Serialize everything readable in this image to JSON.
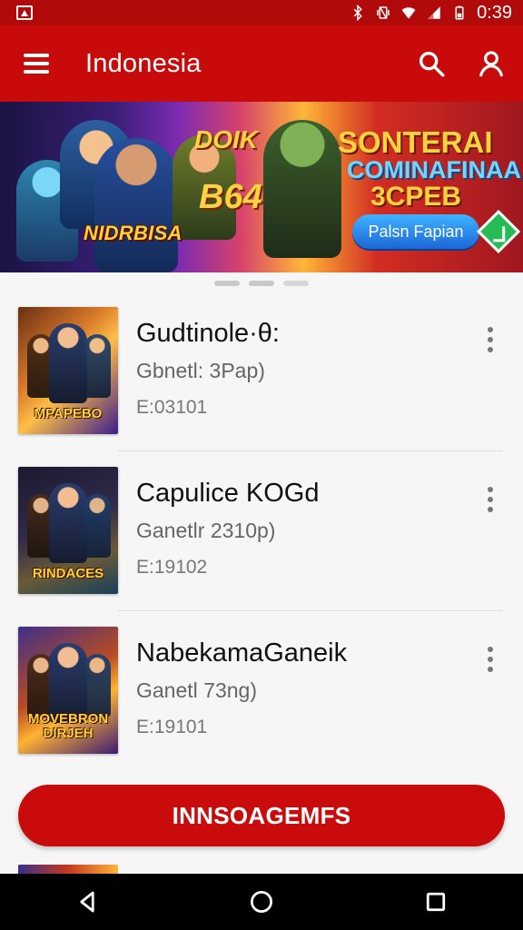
{
  "status_bar": {
    "time": "0:39",
    "icons": [
      "notification-icon",
      "bluetooth-icon",
      "vibrate-icon",
      "wifi-icon",
      "signal-icon",
      "battery-icon"
    ]
  },
  "app_bar": {
    "title": "Indonesia",
    "icons": [
      "menu-icon",
      "search-icon",
      "account-icon"
    ],
    "accent_color": "#c80a0a"
  },
  "banner": {
    "brand_text": "NIDRBISA",
    "center_text_1": "DOIK",
    "center_text_2": "B64",
    "promo_line_1": "SONTERAI",
    "promo_line_2": "COMINAFINAA",
    "promo_line_3": "3CPEB",
    "cta_label": "Palsn Fapian",
    "carousel_dots": 3,
    "active_dot": 1
  },
  "list": {
    "items": [
      {
        "title": "Gudtinole·θ:",
        "subtitle": "Gbnetl: 3Pap)",
        "meta": "E:03101",
        "thumb_caption": "MPAPEBO"
      },
      {
        "title": "Capulice KOGd",
        "subtitle": "Ganetlr 2310p)",
        "meta": "E:19102",
        "thumb_caption": "RINDACES"
      },
      {
        "title": "NabekamaGaneik",
        "subtitle": "Ganetl 73ng)",
        "meta": "E:19101",
        "thumb_caption": "MOVEBRON DIRJEH"
      }
    ]
  },
  "primary_action": {
    "label": "INNSOAGEMFS"
  },
  "navbar": {
    "icons": [
      "back-icon",
      "home-icon",
      "recents-icon"
    ]
  }
}
